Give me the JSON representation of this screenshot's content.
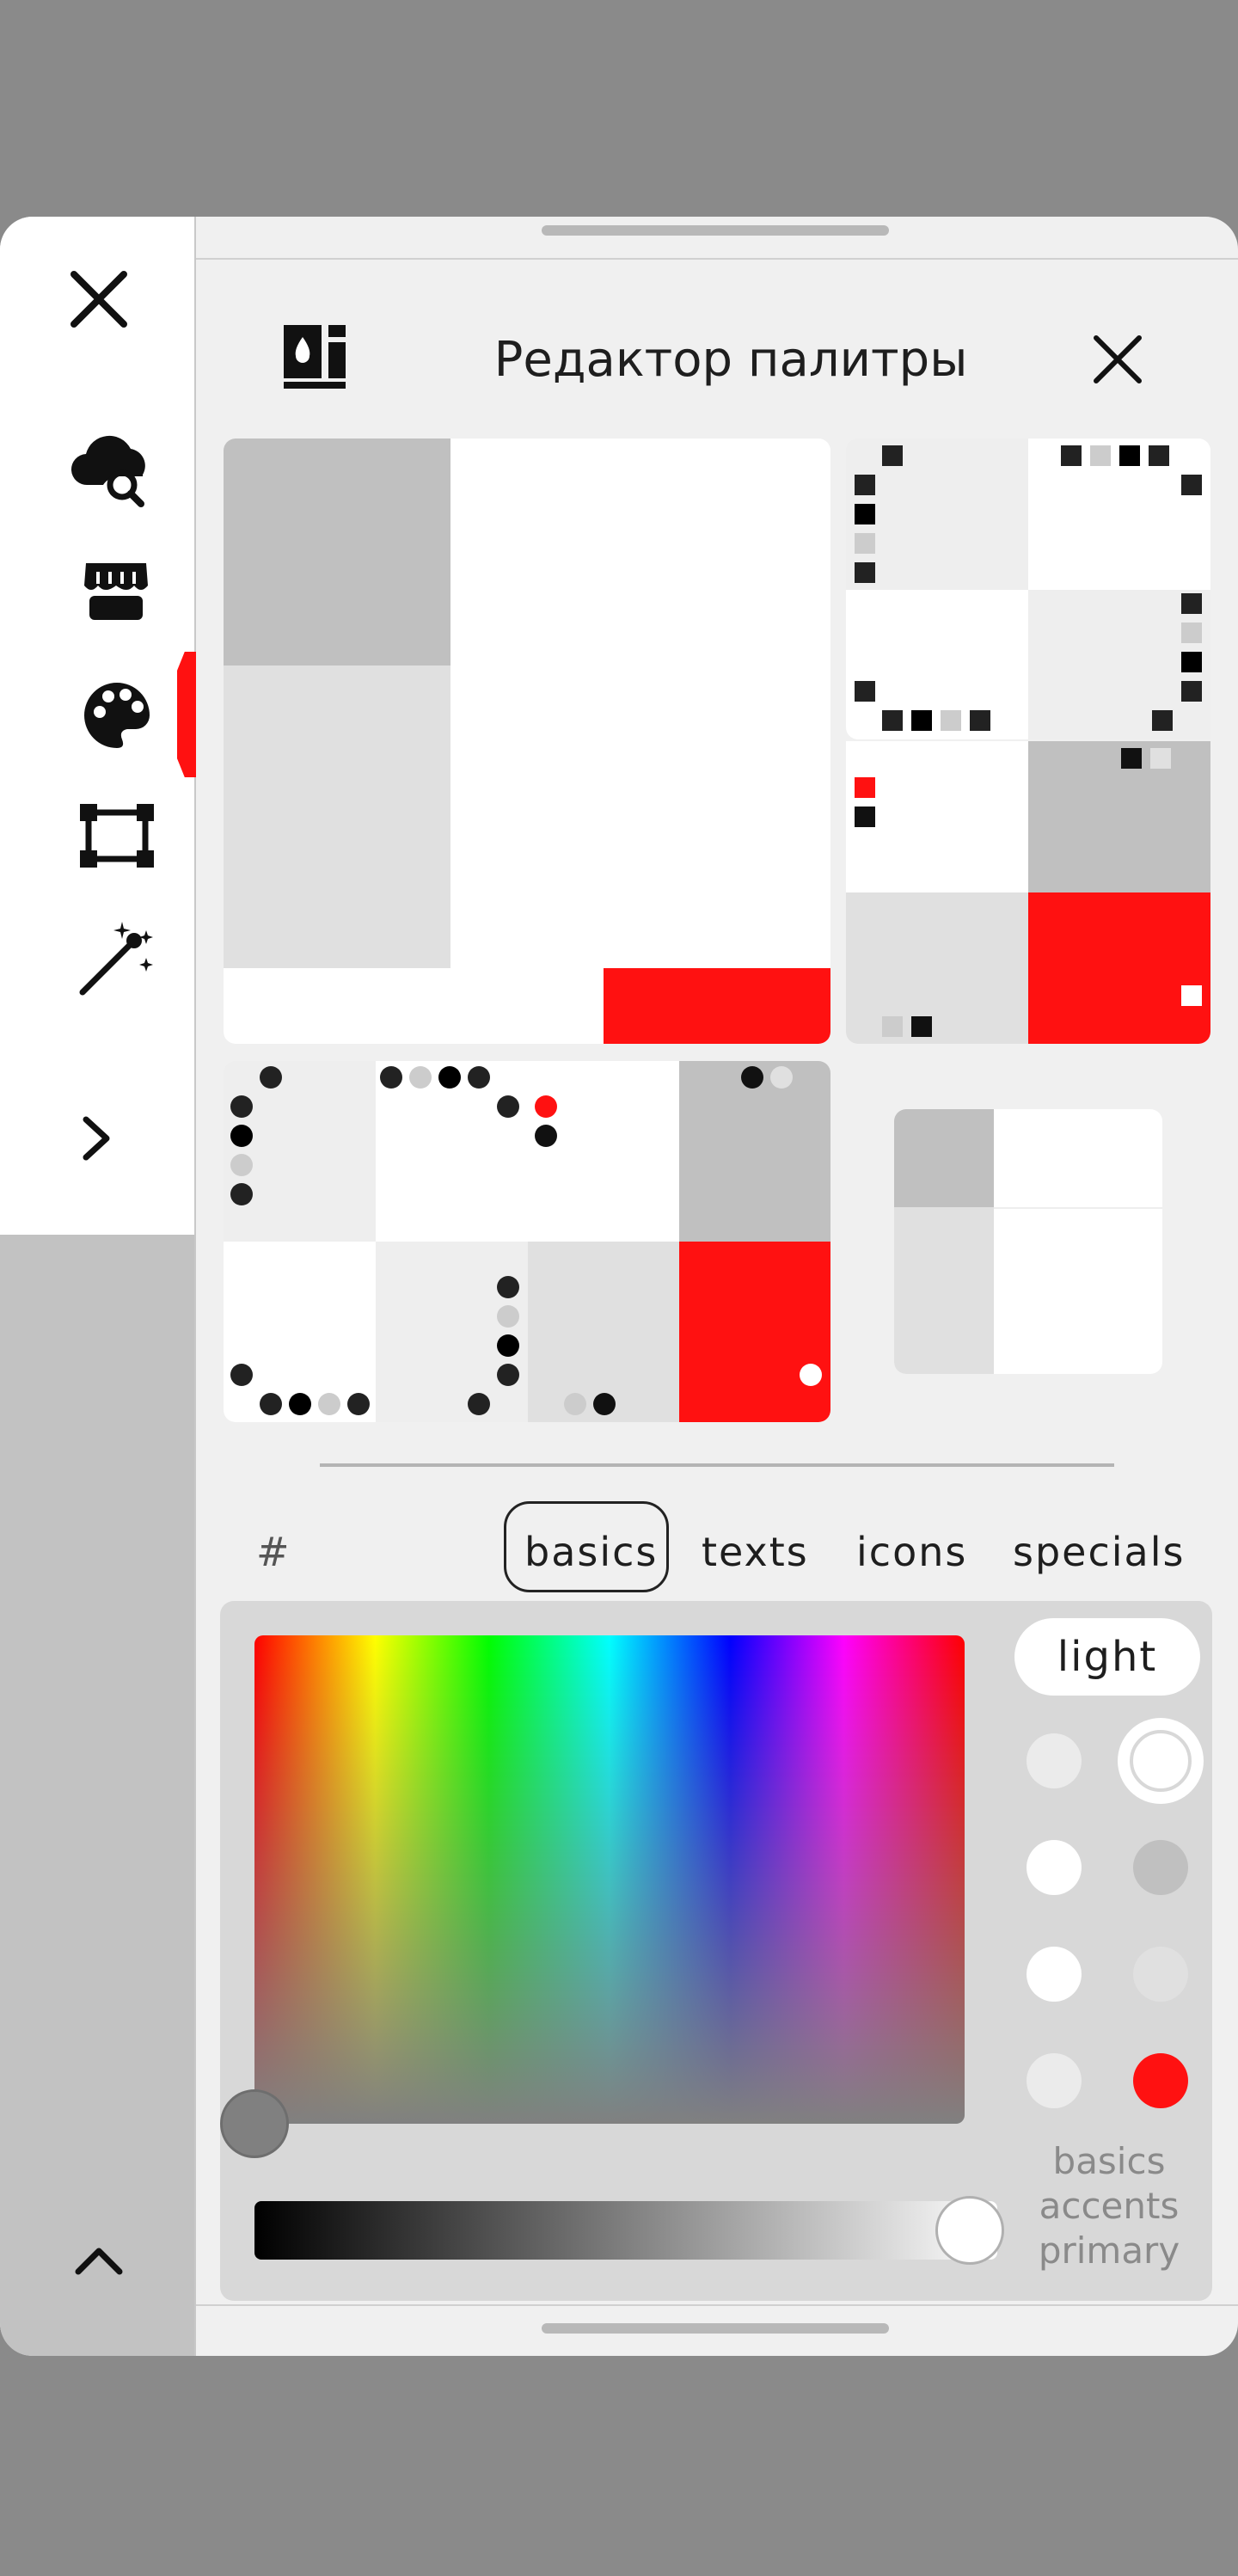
{
  "header": {
    "title": "Редактор палитры"
  },
  "tabs": {
    "hash": "#",
    "items": [
      "basics",
      "texts",
      "icons",
      "specials"
    ],
    "active": "basics"
  },
  "picker": {
    "mode_label": "light",
    "legend": [
      "basics",
      "accents",
      "primary"
    ],
    "lightness_value": 1.0
  },
  "sidebar": {
    "items": [
      "close-icon",
      "cloud-search-icon",
      "store-icon",
      "palette-icon",
      "transform-icon",
      "magic-wand-icon",
      "chevron-right-icon",
      "chevron-up-icon"
    ],
    "active": "palette-icon"
  },
  "colors": {
    "accent": "#ff1111",
    "gray_dark": "#c0c0c0",
    "gray_light": "#e0e0e0",
    "white": "#ffffff",
    "panel": "#f0f0f0"
  }
}
